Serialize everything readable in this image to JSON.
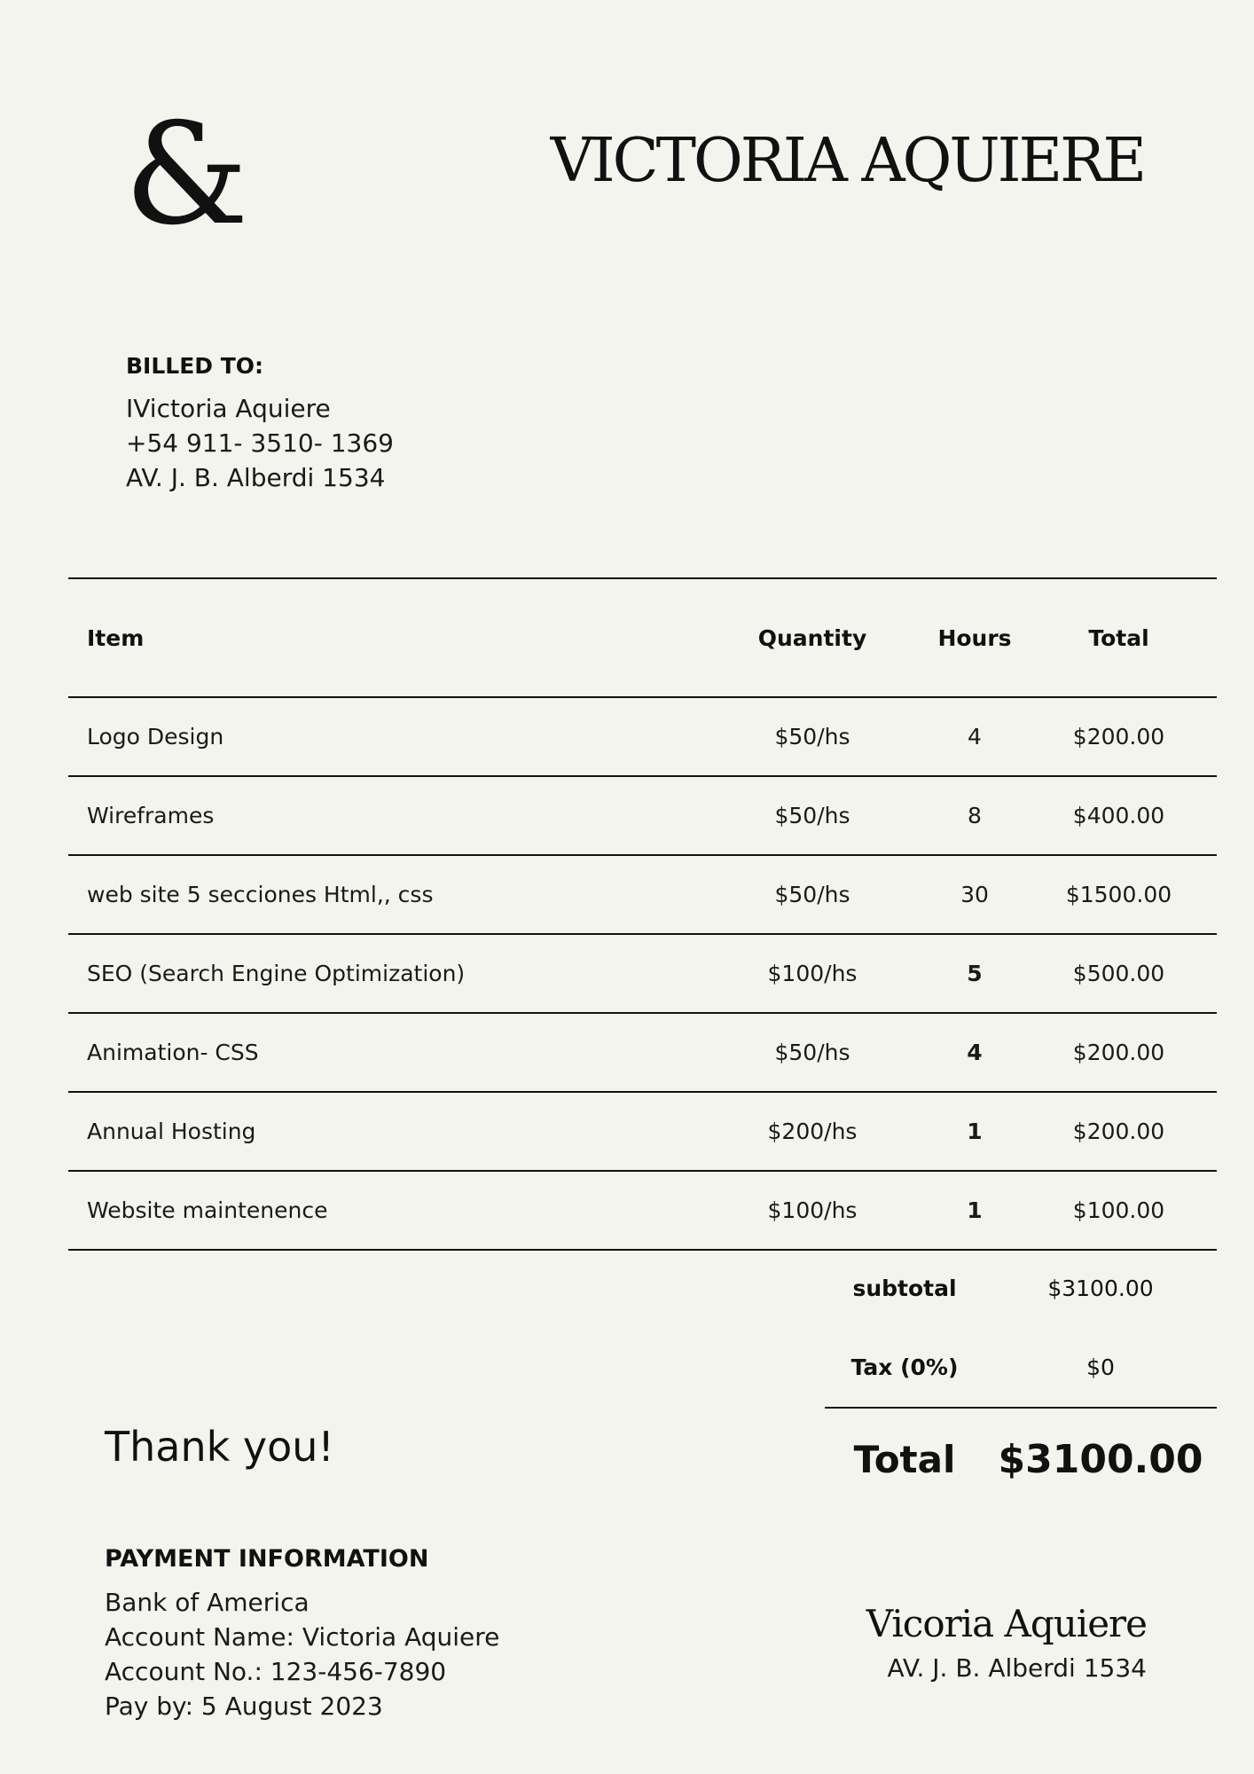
{
  "header": {
    "logo_glyph": "&",
    "brand_name": "VICTORIA AQUIERE"
  },
  "billed_to": {
    "label": "BILLED TO:",
    "name": "IVictoria Aquiere",
    "phone": "+54 911- 3510- 1369",
    "address": "AV. J. B. Alberdi 1534"
  },
  "table": {
    "headers": {
      "item": "Item",
      "quantity": "Quantity",
      "hours": "Hours",
      "total": "Total"
    },
    "rows": [
      {
        "item": "Logo Design",
        "quantity": "$50/hs",
        "hours": "4",
        "total": "$200.00"
      },
      {
        "item": "Wireframes",
        "quantity": "$50/hs",
        "hours": "8",
        "total": "$400.00"
      },
      {
        "item": "web site 5 secciones Html,, css",
        "quantity": "$50/hs",
        "hours": "30",
        "total": "$1500.00"
      },
      {
        "item": "SEO (Search Engine Optimization)",
        "quantity": "$100/hs",
        "hours": "5",
        "total": "$500.00"
      },
      {
        "item": "Animation- CSS",
        "quantity": "$50/hs",
        "hours": "4",
        "total": "$200.00"
      },
      {
        "item": "Annual Hosting",
        "quantity": "$200/hs",
        "hours": "1",
        "total": "$200.00"
      },
      {
        "item": "Website maintenence",
        "quantity": "$100/hs",
        "hours": "1",
        "total": "$100.00"
      }
    ]
  },
  "summary": {
    "subtotal_label": "subtotal",
    "subtotal_value": "$3100.00",
    "tax_label": "Tax (0%)",
    "tax_value": "$0",
    "total_label": "Total",
    "total_value": "$3100.00"
  },
  "thank_you": "Thank you!",
  "payment": {
    "label": "PAYMENT INFORMATION",
    "bank": "Bank of America",
    "account_name": "Account Name: Victoria Aquiere",
    "account_no": "Account No.: 123-456-7890",
    "pay_by": "Pay by: 5 August 2023"
  },
  "signature": {
    "name": "Vicoria Aquiere",
    "address": "AV. J. B. Alberdi 1534"
  }
}
